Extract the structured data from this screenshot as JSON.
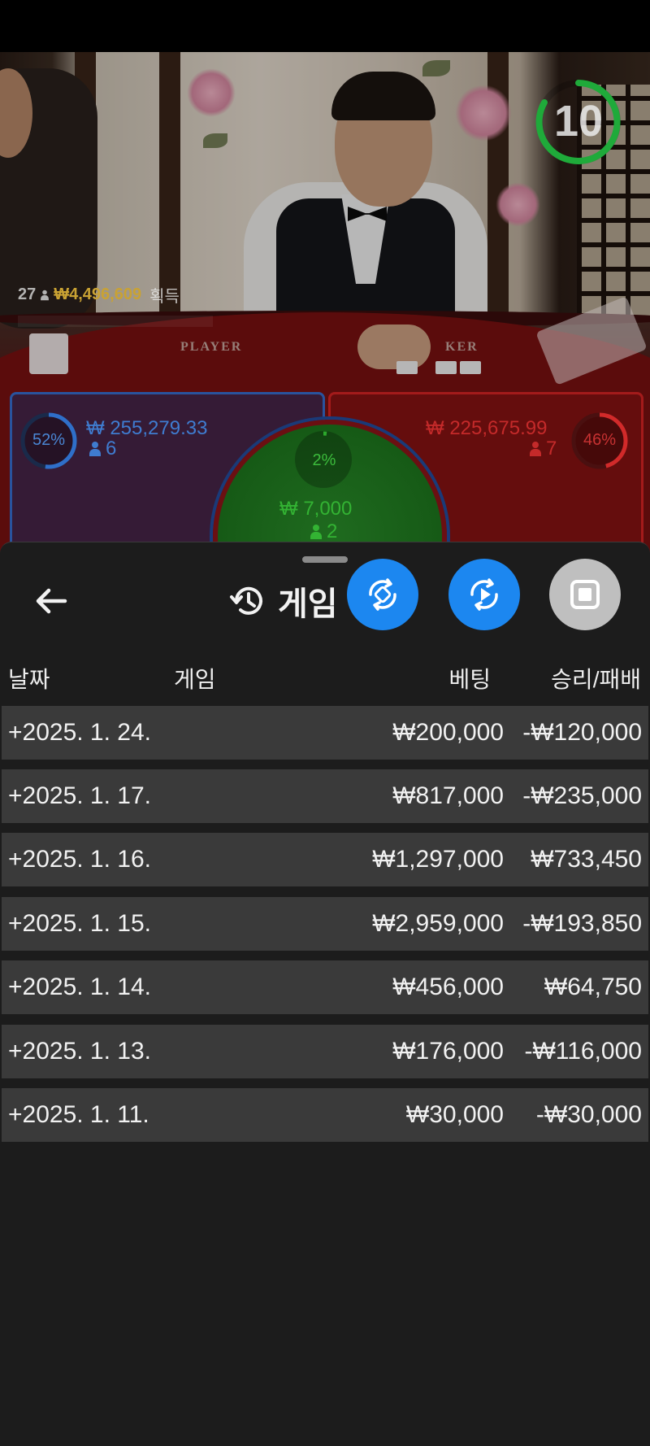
{
  "live": {
    "timer_value": "10",
    "ticker": {
      "count": "27",
      "amount": "₩4,496,609",
      "won_label": "획득"
    },
    "table_labels": {
      "player": "PLAYER",
      "banker": "KER"
    },
    "colors": {
      "player": "#2f6fc9",
      "banker": "#d12a2a",
      "tie": "#2ca82c",
      "timer": "#1faa3a",
      "ticker_amount": "#c9a233"
    },
    "player_spot": {
      "percent": "52%",
      "percent_value": 0.52,
      "amount": "₩ 255,279.33",
      "players": "6"
    },
    "banker_spot": {
      "percent": "46%",
      "percent_value": 0.46,
      "amount": "₩ 225,675.99",
      "players": "7"
    },
    "tie_spot": {
      "percent": "2%",
      "percent_value": 0.02,
      "amount": "₩ 7,000",
      "players": "2"
    }
  },
  "panel": {
    "title": "게임",
    "icons": {
      "back": "arrow-left-icon",
      "history": "history-icon",
      "fab1": "rotate-link-icon",
      "fab2": "replay-icon",
      "fab3": "stop-icon"
    },
    "columns": {
      "date": "날짜",
      "game": "게임",
      "bet": "베팅",
      "result": "승리/패배"
    },
    "rows": [
      {
        "date": "+2025. 1. 24.",
        "bet": "₩200,000",
        "result": "-₩120,000"
      },
      {
        "date": "+2025. 1. 17.",
        "bet": "₩817,000",
        "result": "-₩235,000"
      },
      {
        "date": "+2025. 1. 16.",
        "bet": "₩1,297,000",
        "result": "₩733,450"
      },
      {
        "date": "+2025. 1. 15.",
        "bet": "₩2,959,000",
        "result": "-₩193,850"
      },
      {
        "date": "+2025. 1. 14.",
        "bet": "₩456,000",
        "result": "₩64,750"
      },
      {
        "date": "+2025. 1. 13.",
        "bet": "₩176,000",
        "result": "-₩116,000"
      },
      {
        "date": "+2025. 1. 11.",
        "bet": "₩30,000",
        "result": "-₩30,000"
      }
    ]
  }
}
